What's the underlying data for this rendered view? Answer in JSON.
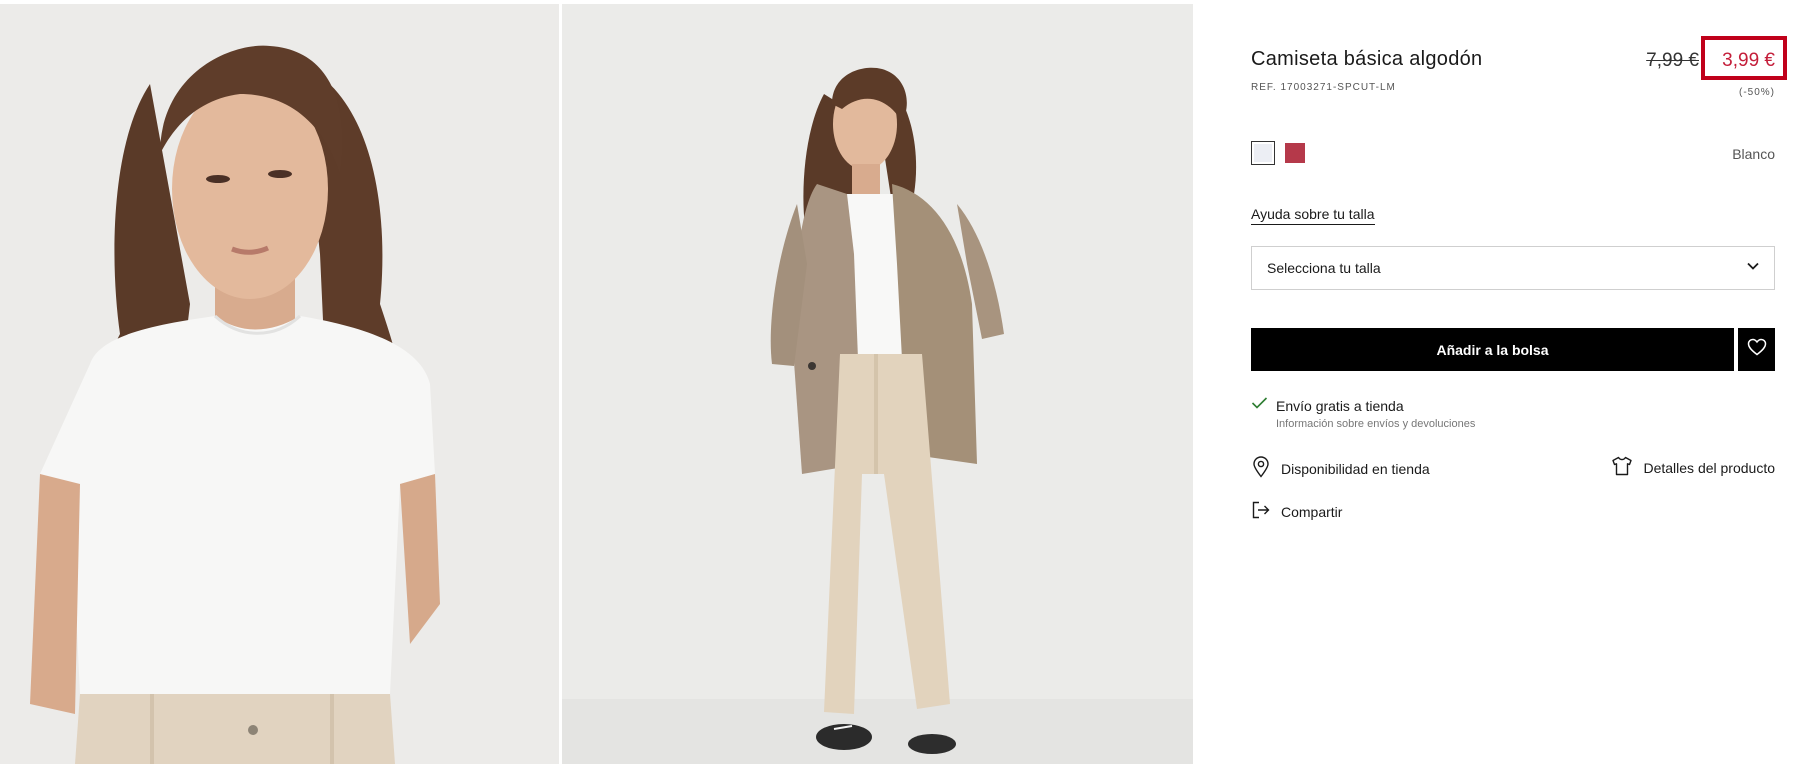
{
  "product": {
    "title": "Camiseta básica algodón",
    "ref": "REF. 17003271-SPCUT-LM",
    "old_price": "7,99 €",
    "new_price": "3,99 €",
    "discount": "(-50%)",
    "color_name": "Blanco"
  },
  "colors": {
    "accent_red": "#c0001a",
    "price_red": "#c41e3a",
    "swatch_white": "#eceef4",
    "swatch_red": "#b5394a"
  },
  "size": {
    "help_link": "Ayuda sobre tu talla",
    "select_label": "Selecciona tu talla"
  },
  "actions": {
    "add_to_bag": "Añadir a la bolsa",
    "shipping_main": "Envío gratis a tienda",
    "shipping_sub": "Información sobre envíos y devoluciones",
    "availability": "Disponibilidad en tienda",
    "details": "Detalles del producto",
    "share": "Compartir"
  },
  "icons": {
    "favorite": "heart-icon",
    "dropdown": "chevron-down-icon",
    "shipping": "check-icon",
    "availability": "location-pin-icon",
    "details": "tshirt-icon",
    "share": "share-icon"
  }
}
